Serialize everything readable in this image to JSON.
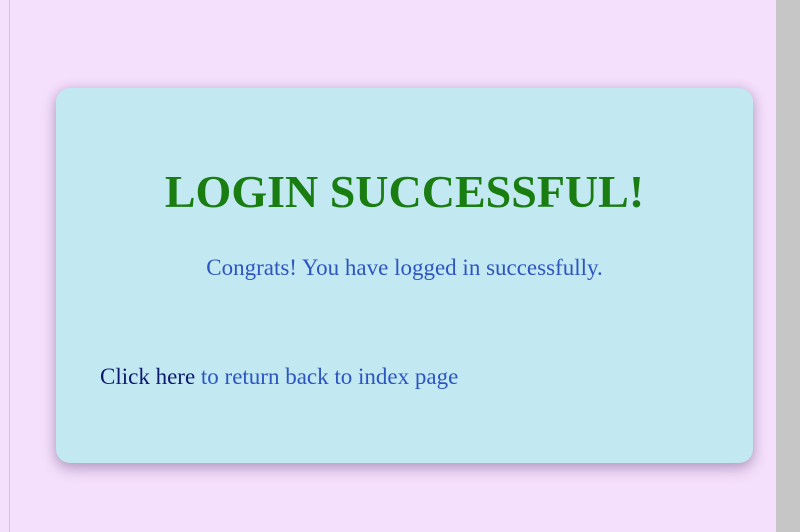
{
  "message": {
    "title": "LOGIN SUCCESSFUL!",
    "subtitle": "Congrats! You have logged in successfully."
  },
  "return_prompt": {
    "link_text": "Click here",
    "rest_text": " to return back to index page"
  },
  "colors": {
    "page_background": "#f4dffc",
    "card_background": "#c2e8f2",
    "title": "#1a7d12",
    "text": "#2d55c0",
    "link": "#0d1a6e"
  }
}
